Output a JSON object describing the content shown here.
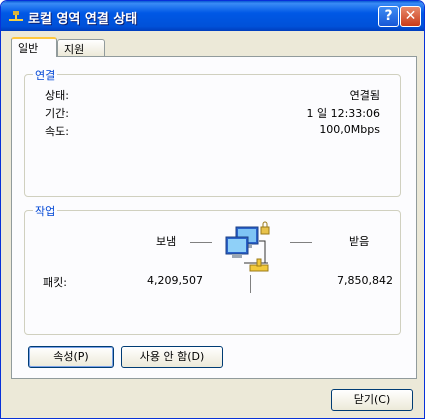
{
  "window": {
    "title": "로컬 영역 연결 상태",
    "help": "?",
    "close": "✕"
  },
  "tabs": [
    {
      "label": "일반"
    },
    {
      "label": "지원"
    }
  ],
  "connection": {
    "group_label": "연결",
    "rows": [
      {
        "label": "상태:",
        "value": "연결됨"
      },
      {
        "label": "기간:",
        "value": "1 일 12:33:06"
      },
      {
        "label": "속도:",
        "value": "100,0Mbps"
      }
    ]
  },
  "activity": {
    "group_label": "작업",
    "sent_label": "보냄",
    "received_label": "받음",
    "packets_label": "패킷:",
    "sent_value": "4,209,507",
    "received_value": "7,850,842"
  },
  "buttons": {
    "properties": "속성(P)",
    "disable": "사용 안 함(D)",
    "close": "닫기(C)"
  }
}
